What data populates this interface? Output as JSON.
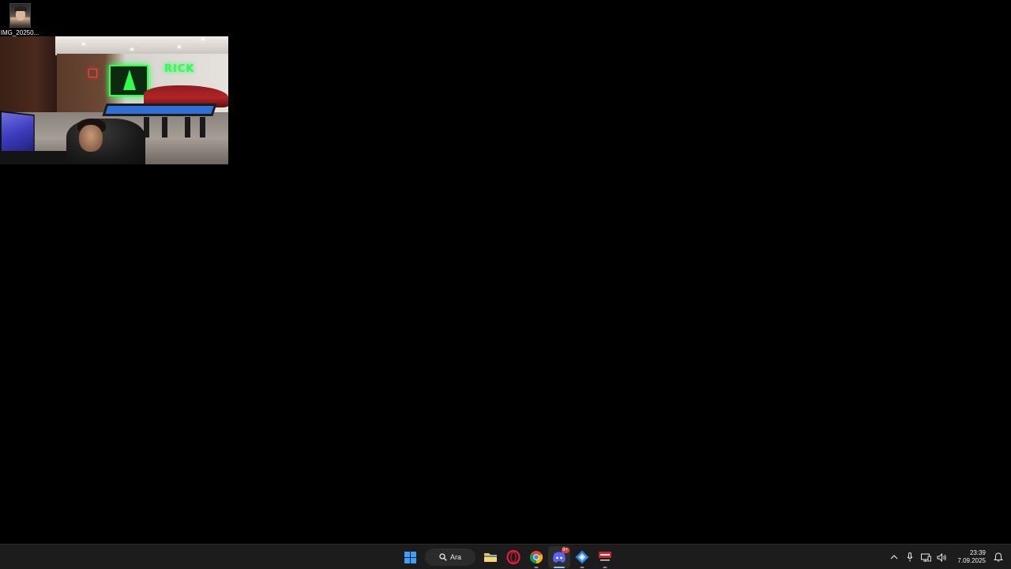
{
  "desktop": {
    "icons": [
      {
        "label": "IMG_20250...",
        "icon": "image-thumbnail-icon"
      }
    ]
  },
  "video_window": {
    "sign_text": "RICK"
  },
  "taskbar": {
    "start_icon": "windows-start-icon",
    "search": {
      "label": "Ara",
      "icon": "search-icon"
    },
    "apps": [
      {
        "name": "File Explorer",
        "icon": "folder-icon"
      },
      {
        "name": "Opera",
        "icon": "opera-icon"
      },
      {
        "name": "Chrome",
        "icon": "chrome-icon"
      },
      {
        "name": "Discord",
        "icon": "discord-icon",
        "badge": "9+"
      },
      {
        "name": "App",
        "icon": "blue-diamond-app-icon"
      },
      {
        "name": "Video Writer",
        "icon": "video-writer-icon"
      }
    ],
    "tray": {
      "icons": [
        "chevron-up-icon",
        "microphone-icon",
        "network-icon",
        "volume-icon",
        "notification-icon"
      ],
      "time": "23:39",
      "date": "7.09.2025"
    },
    "colors": {
      "accent": "#3aa0ff",
      "background": "#1c1c1c"
    }
  }
}
